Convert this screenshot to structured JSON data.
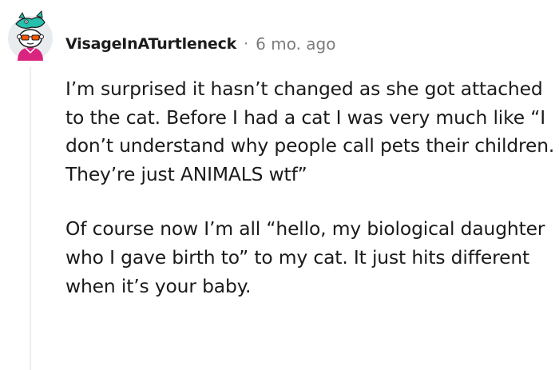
{
  "comment": {
    "author": "VisageInATurtleneck",
    "separator": "·",
    "timestamp": "6 mo. ago",
    "paragraphs": [
      "I’m surprised it hasn’t changed as she got attached to the cat. Before I had a cat I was very much like “I don’t understand why people call pets their children. They’re just ANIMALS wtf”",
      "Of course now I’m all “hello, my biological daughter who I gave birth to” to my cat. It just hits different when it’s your baby."
    ]
  },
  "colors": {
    "text": "#1a1a1b",
    "meta": "#7c7c7c",
    "thread_line": "#edeff1",
    "avatar_bg": "#e9ecef",
    "avatar_shirt": "#d9257f",
    "avatar_glasses": "#ff5700",
    "avatar_accessory": "#24c0ad"
  },
  "icons": {
    "avatar": "snoo-avatar-icon"
  }
}
